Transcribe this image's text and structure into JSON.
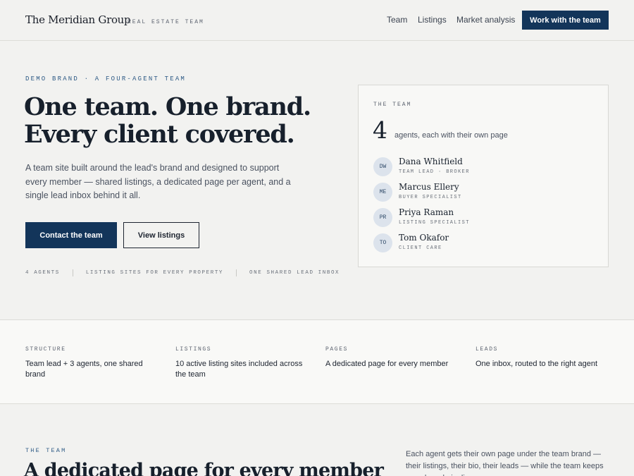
{
  "header": {
    "brand": "The Meridian Group",
    "brand_tag": "REAL ESTATE TEAM",
    "nav": [
      "Team",
      "Listings",
      "Market analysis"
    ],
    "cta": "Work with the team"
  },
  "hero": {
    "eyebrow": "DEMO BRAND · A FOUR-AGENT TEAM",
    "title_line1": "One team. One brand.",
    "title_line2": "Every client covered.",
    "subtitle": "A team site built around the lead's brand and designed to support every member — shared listings, a dedicated page per agent, and a single lead inbox behind it all.",
    "primary_button": "Contact the team",
    "secondary_button": "View listings",
    "stats": [
      "4 AGENTS",
      "LISTING SITES FOR EVERY PROPERTY",
      "ONE SHARED LEAD INBOX"
    ]
  },
  "team_card": {
    "label": "THE TEAM",
    "count": "4",
    "count_label": "agents, each with their own page",
    "agents": [
      {
        "initials": "DW",
        "name": "Dana Whitfield",
        "role": "TEAM LEAD · BROKER"
      },
      {
        "initials": "ME",
        "name": "Marcus Ellery",
        "role": "BUYER SPECIALIST"
      },
      {
        "initials": "PR",
        "name": "Priya Raman",
        "role": "LISTING SPECIALIST"
      },
      {
        "initials": "TO",
        "name": "Tom Okafor",
        "role": "CLIENT CARE"
      }
    ]
  },
  "features": [
    {
      "label": "STRUCTURE",
      "text": "Team lead + 3 agents, one shared brand"
    },
    {
      "label": "LISTINGS",
      "text": "10 active listing sites included across the team"
    },
    {
      "label": "PAGES",
      "text": "A dedicated page for every member"
    },
    {
      "label": "LEADS",
      "text": "One inbox, routed to the right agent"
    }
  ],
  "section": {
    "eyebrow": "THE TEAM",
    "title": "A dedicated page for every member",
    "description": "Each agent gets their own page under the team brand — their listings, their bio, their leads — while the team keeps one shared pipeline."
  },
  "colors": {
    "accent": "#13355a",
    "eyebrow": "#2f5b86",
    "background": "#f2f2f0"
  }
}
